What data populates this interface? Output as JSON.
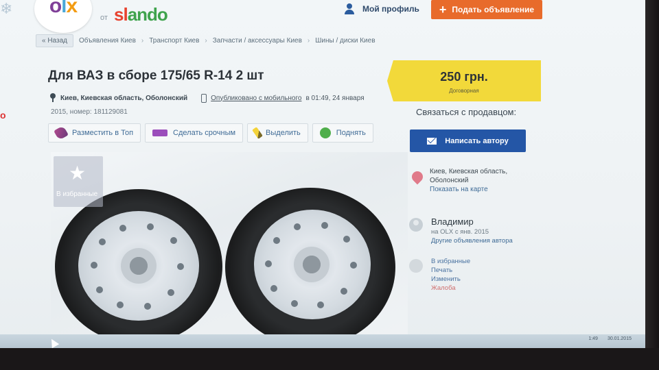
{
  "header": {
    "logo": "OLX",
    "ot": "от",
    "slando": "slando",
    "profile_label": "Мой профиль",
    "post_button": "Подать объявление"
  },
  "breadcrumb": {
    "back": "« Назад",
    "items": [
      "Объявления Киев",
      "Транспорт Киев",
      "Запчасти / аксессуары Киев",
      "Шины / диски Киев"
    ]
  },
  "ad": {
    "title": "Для ВАЗ в сборе 175/65 R-14 2 шт",
    "location": "Киев, Киевская область, Оболонский",
    "published_link": "Опубликовано с мобильного",
    "published_time": "в 01:49, 24 января",
    "number_line": "2015, номер: 181129081"
  },
  "actions": [
    {
      "label": "Разместить в Топ",
      "icon": "rocket-icon"
    },
    {
      "label": "Сделать срочным",
      "icon": "urgent-icon"
    },
    {
      "label": "Выделить",
      "icon": "marker-icon"
    },
    {
      "label": "Поднять",
      "icon": "up-icon"
    }
  ],
  "photo": {
    "favorite_label": "В избранные"
  },
  "sidebar": {
    "price": "250 грн.",
    "price_note": "Договорная",
    "contact_title": "Связаться с продавцом:",
    "write_button": "Написать автору",
    "location_line1": "Киев, Киевская область,",
    "location_line2": "Оболонский",
    "map_link": "Показать на карте",
    "seller_name": "Владимир",
    "seller_since": "на OLX с янв. 2015",
    "seller_other": "Другие объявления автора",
    "links": [
      "В избранные",
      "Печать",
      "Изменить",
      "Жалоба"
    ]
  },
  "taskbar": {
    "time": "1:49",
    "date": "30.01.2015"
  },
  "colors": {
    "accent_orange": "#e86b2b",
    "price_yellow": "#f2d93a",
    "button_blue": "#2456a6"
  }
}
